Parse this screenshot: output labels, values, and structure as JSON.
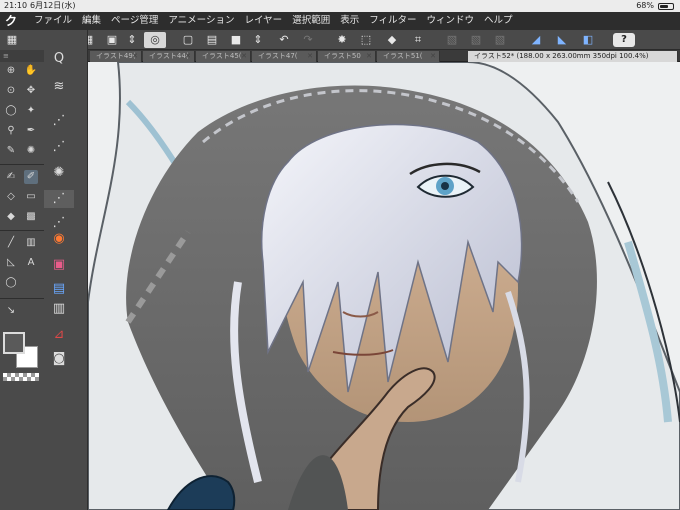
{
  "status_bar": {
    "time": "21:10",
    "date": "6月12日(水)",
    "battery_percent": "68%",
    "battery_level": 0.68
  },
  "menu": {
    "logo": "ク",
    "items": [
      "ファイル",
      "編集",
      "ページ管理",
      "アニメーション",
      "レイヤー",
      "選択範囲",
      "表示",
      "フィルター",
      "ウィンドウ",
      "ヘルプ"
    ]
  },
  "toolbar": {
    "help_label": "?"
  },
  "tabs": [
    {
      "label": "イラスト49(",
      "active": false
    },
    {
      "label": "イラスト44(",
      "active": false
    },
    {
      "label": "イラスト45(",
      "active": false
    },
    {
      "label": "イラスト47(",
      "active": false
    },
    {
      "label": "イラスト50",
      "active": false
    },
    {
      "label": "イラスト51(",
      "active": false
    },
    {
      "label": "イラスト52* (188.00 x 263.00mm 350dpi 100.4%)",
      "active": true
    }
  ],
  "tool_palette": {
    "header": "≡"
  },
  "colors": {
    "main_color": "#5a5a5a",
    "sub_color": "#ffffff",
    "accent": "#7fb4ff"
  },
  "icons": {
    "help": "question-icon",
    "close_tab": "close-icon"
  }
}
